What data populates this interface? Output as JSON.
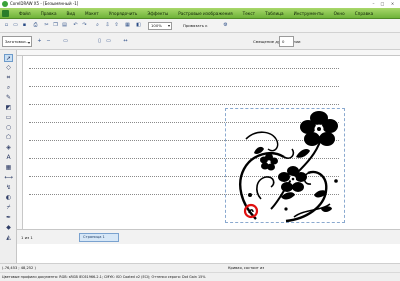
{
  "window": {
    "title": "CorelDRAW X5 - [Безымянный -1]",
    "minimize_glyph": "–",
    "maximize_glyph": "□",
    "close_glyph": "×"
  },
  "menubar": {
    "items": [
      "Файл",
      "Правка",
      "Вид",
      "Макет",
      "Упорядочить",
      "Эффекты",
      "Растровые изображения",
      "Текст",
      "Таблица",
      "Инструменты",
      "Окно",
      "Справка"
    ]
  },
  "toolbar": {
    "zoom_value": "100%",
    "snap_label": "Привязать к"
  },
  "property_bar": {
    "preset_value": "Заготовки...",
    "dup_label": "Смещение дубля копии",
    "dup_value": "0"
  },
  "pages": {
    "counter": "1 из 1",
    "tab_label": "Страница 1"
  },
  "status": {
    "coords": "(-76,453 ; 48,252 )",
    "object": "Кривая, состоит из",
    "doc_info": "Цветовые профили документа: RGB: sRGB IEC61966-2.1; CMYK: ISO Coated v2 (ECI); Оттенки серого: Dot Gain 15%"
  },
  "colors": {
    "menubar": "#7dbb45",
    "selection_dash": "#8aa9cf",
    "highlight_circle": "#e01010",
    "ornament": "#000000"
  }
}
